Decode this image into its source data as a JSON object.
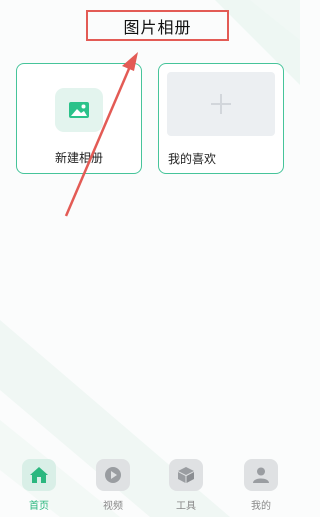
{
  "header": {
    "title": "图片相册"
  },
  "albums": {
    "new_album_label": "新建相册",
    "favorites_label": "我的喜欢"
  },
  "tabbar": {
    "tabs": [
      {
        "label": "首页",
        "icon": "home-icon",
        "active": true
      },
      {
        "label": "视频",
        "icon": "play-icon",
        "active": false
      },
      {
        "label": "工具",
        "icon": "cube-icon",
        "active": false
      },
      {
        "label": "我的",
        "icon": "user-icon",
        "active": false
      }
    ]
  },
  "colors": {
    "accent": "#2bb77f",
    "card_border": "#46c49a",
    "annotation_red": "#e35b55"
  }
}
